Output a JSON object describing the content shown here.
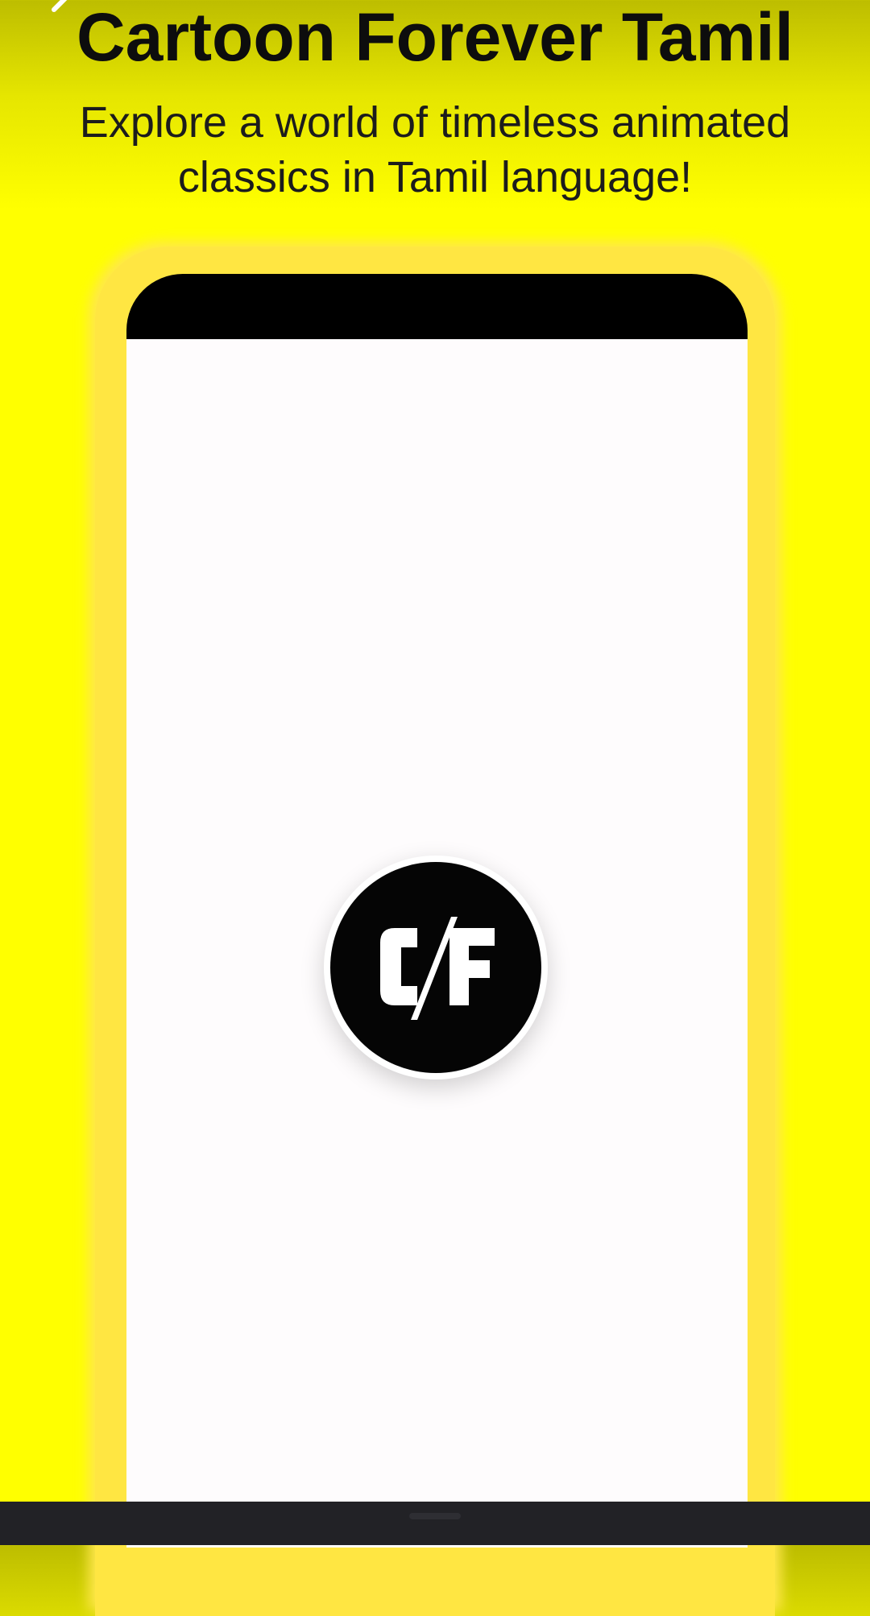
{
  "header": {
    "title": "Cartoon Forever Tamil",
    "subtitle_line1": "Explore a world of timeless animated",
    "subtitle_line2": "classics in Tamil language!"
  },
  "logo": {
    "text": "CF"
  },
  "icons": {
    "back": "back-arrow-icon",
    "logo": "cf-logo-icon"
  },
  "colors": {
    "background": "#ffff00",
    "phone_frame": "#ffe642",
    "phone_screen": "#fefcfd",
    "notch_bar": "#000000",
    "logo_circle": "#050505",
    "nav_bar": "#222226"
  }
}
